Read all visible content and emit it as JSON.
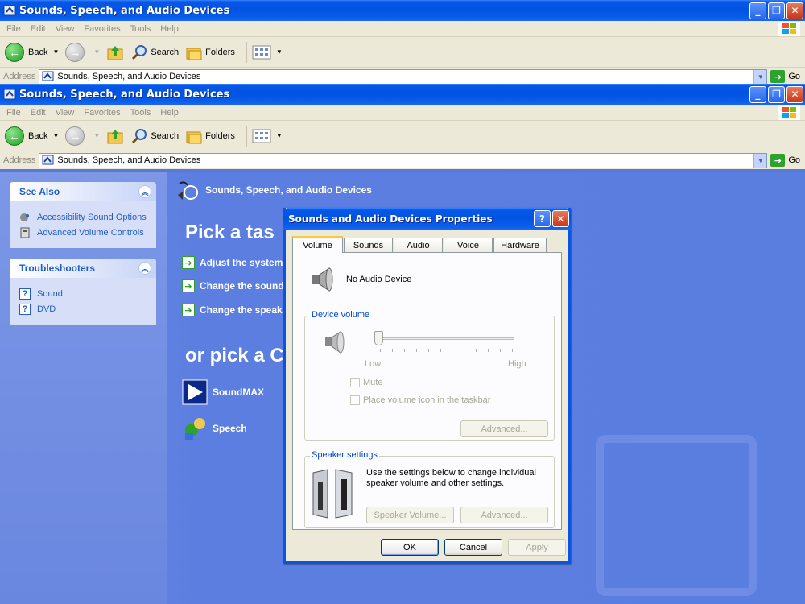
{
  "window": {
    "title": "Sounds, Speech, and Audio Devices",
    "menu": [
      "File",
      "Edit",
      "View",
      "Favorites",
      "Tools",
      "Help"
    ],
    "toolbar": {
      "back": "Back",
      "search": "Search",
      "folders": "Folders"
    },
    "address_label": "Address",
    "address_value": "Sounds, Speech, and Audio Devices",
    "go": "Go"
  },
  "see_also": {
    "title": "See Also",
    "items": [
      "Accessibility Sound Options",
      "Advanced Volume Controls"
    ]
  },
  "troubleshooters": {
    "title": "Troubleshooters",
    "items": [
      "Sound",
      "DVD"
    ]
  },
  "main": {
    "header": "Sounds, Speech, and Audio Devices",
    "pick_task": "Pick a tas",
    "tasks": [
      "Adjust the system",
      "Change the sound s",
      "Change the speake"
    ],
    "pick_icon": "or pick a C",
    "items": [
      "SoundMAX",
      "Speech"
    ]
  },
  "dialog": {
    "title": "Sounds and Audio Devices Properties",
    "tabs": [
      "Volume",
      "Sounds",
      "Audio",
      "Voice",
      "Hardware"
    ],
    "active_tab": "Volume",
    "device_name": "No Audio Device",
    "device_volume": {
      "label": "Device volume",
      "low": "Low",
      "high": "High",
      "level": 0,
      "mute": "Mute",
      "taskbar": "Place volume icon in the taskbar",
      "advanced": "Advanced..."
    },
    "speaker_settings": {
      "label": "Speaker settings",
      "text": "Use the settings below to change individual speaker volume and other settings.",
      "speaker_volume": "Speaker Volume...",
      "advanced": "Advanced..."
    },
    "buttons": {
      "ok": "OK",
      "cancel": "Cancel",
      "apply": "Apply"
    }
  }
}
